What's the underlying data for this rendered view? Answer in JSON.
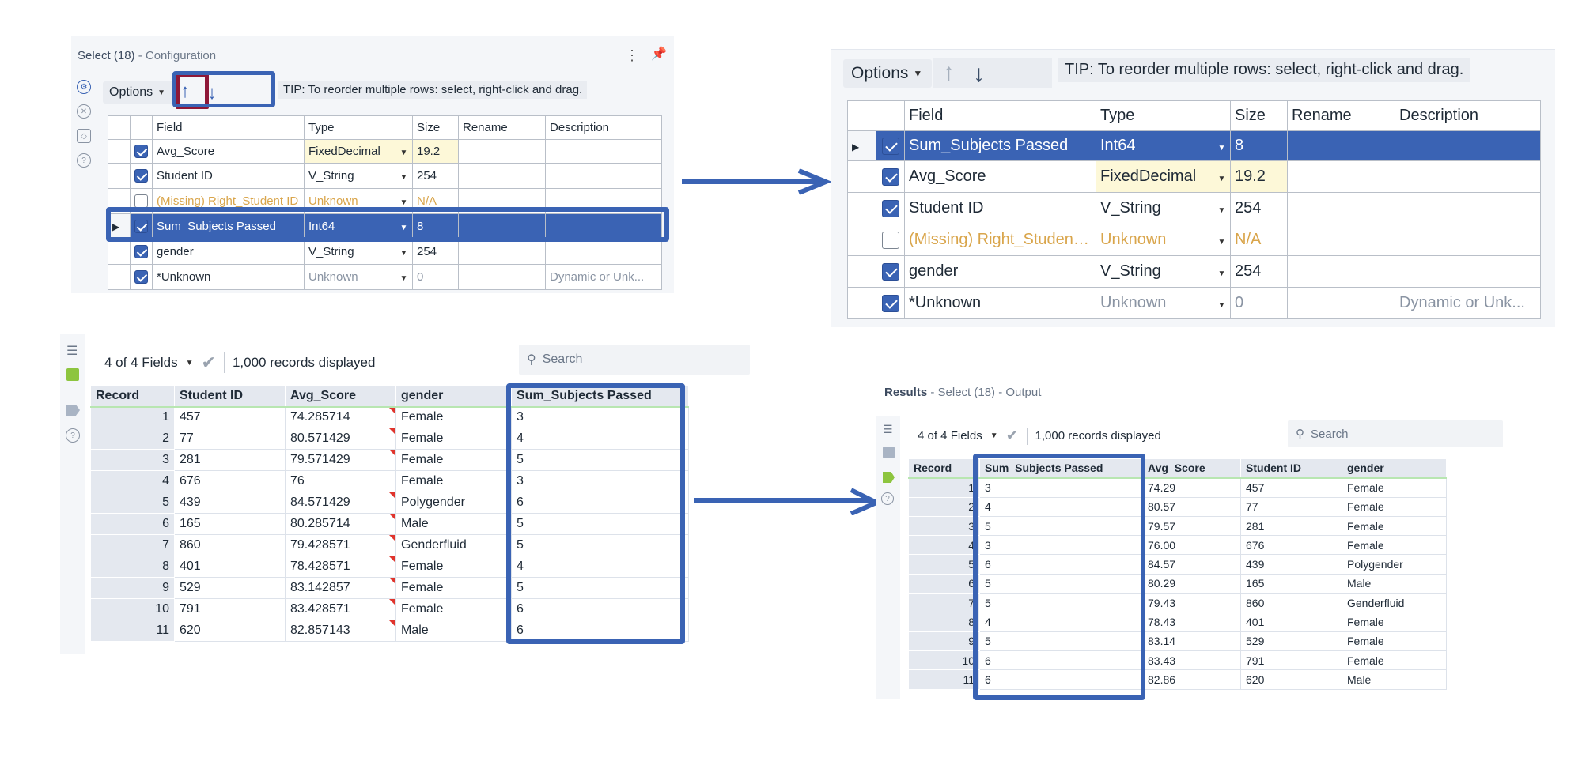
{
  "colors": {
    "selected_row": "#3a63b4",
    "annotation_blue": "#3a63b4",
    "annotation_red": "#8e1838",
    "missing_field": "#d9a54b",
    "flag_red": "#e0342c"
  },
  "config_panel": {
    "title": "Select (18)",
    "subtitle": "- Configuration",
    "options_label": "Options",
    "tip": "TIP: To reorder multiple rows: select, right-click and drag.",
    "columns": [
      "Field",
      "Type",
      "Size",
      "Rename",
      "Description"
    ]
  },
  "config_before": [
    {
      "checked": true,
      "field": "Avg_Score",
      "type": "FixedDecimal",
      "size": "19.2",
      "rename": "",
      "description": ""
    },
    {
      "checked": true,
      "field": "Student ID",
      "type": "V_String",
      "size": "254",
      "rename": "",
      "description": ""
    },
    {
      "checked": false,
      "field": "(Missing) Right_Student ID",
      "type": "Unknown",
      "size": "N/A",
      "rename": "",
      "description": ""
    },
    {
      "checked": true,
      "field": "Sum_Subjects Passed",
      "type": "Int64",
      "size": "8",
      "rename": "",
      "description": ""
    },
    {
      "checked": true,
      "field": "gender",
      "type": "V_String",
      "size": "254",
      "rename": "",
      "description": ""
    },
    {
      "checked": true,
      "field": "*Unknown",
      "type": "Unknown",
      "size": "0",
      "rename": "",
      "description": "Dynamic or Unk..."
    }
  ],
  "config_after": [
    {
      "checked": true,
      "field": "Sum_Subjects Passed",
      "type": "Int64",
      "size": "8",
      "rename": "",
      "description": ""
    },
    {
      "checked": true,
      "field": "Avg_Score",
      "type": "FixedDecimal",
      "size": "19.2",
      "rename": "",
      "description": ""
    },
    {
      "checked": true,
      "field": "Student ID",
      "type": "V_String",
      "size": "254",
      "rename": "",
      "description": ""
    },
    {
      "checked": false,
      "field": "(Missing) Right_Student ID",
      "type": "Unknown",
      "size": "N/A",
      "rename": "",
      "description": ""
    },
    {
      "checked": true,
      "field": "gender",
      "type": "V_String",
      "size": "254",
      "rename": "",
      "description": ""
    },
    {
      "checked": true,
      "field": "*Unknown",
      "type": "Unknown",
      "size": "0",
      "rename": "",
      "description": "Dynamic or Unk..."
    }
  ],
  "results_before": {
    "fields_label": "4 of 4 Fields",
    "records_label": "1,000 records displayed",
    "search_placeholder": "Search",
    "columns": [
      "Record",
      "Student ID",
      "Avg_Score",
      "gender",
      "Sum_Subjects Passed"
    ],
    "rows": [
      [
        "1",
        "457",
        "74.285714",
        "Female",
        "3"
      ],
      [
        "2",
        "77",
        "80.571429",
        "Female",
        "4"
      ],
      [
        "3",
        "281",
        "79.571429",
        "Female",
        "5"
      ],
      [
        "4",
        "676",
        "76",
        "Female",
        "3"
      ],
      [
        "5",
        "439",
        "84.571429",
        "Polygender",
        "6"
      ],
      [
        "6",
        "165",
        "80.285714",
        "Male",
        "5"
      ],
      [
        "7",
        "860",
        "79.428571",
        "Genderfluid",
        "5"
      ],
      [
        "8",
        "401",
        "78.428571",
        "Female",
        "4"
      ],
      [
        "9",
        "529",
        "83.142857",
        "Female",
        "5"
      ],
      [
        "10",
        "791",
        "83.428571",
        "Female",
        "6"
      ],
      [
        "11",
        "620",
        "82.857143",
        "Male",
        "6"
      ]
    ]
  },
  "results_after": {
    "title": "Results",
    "subtitle": "- Select (18) - Output",
    "fields_label": "4 of 4 Fields",
    "records_label": "1,000 records displayed",
    "search_placeholder": "Search",
    "columns": [
      "Record",
      "Sum_Subjects Passed",
      "Avg_Score",
      "Student ID",
      "gender"
    ],
    "rows": [
      [
        "1",
        "3",
        "74.29",
        "457",
        "Female"
      ],
      [
        "2",
        "4",
        "80.57",
        "77",
        "Female"
      ],
      [
        "3",
        "5",
        "79.57",
        "281",
        "Female"
      ],
      [
        "4",
        "3",
        "76.00",
        "676",
        "Female"
      ],
      [
        "5",
        "6",
        "84.57",
        "439",
        "Polygender"
      ],
      [
        "6",
        "5",
        "80.29",
        "165",
        "Male"
      ],
      [
        "7",
        "5",
        "79.43",
        "860",
        "Genderfluid"
      ],
      [
        "8",
        "4",
        "78.43",
        "401",
        "Female"
      ],
      [
        "9",
        "5",
        "83.14",
        "529",
        "Female"
      ],
      [
        "10",
        "6",
        "83.43",
        "791",
        "Female"
      ],
      [
        "11",
        "6",
        "82.86",
        "620",
        "Male"
      ]
    ]
  }
}
